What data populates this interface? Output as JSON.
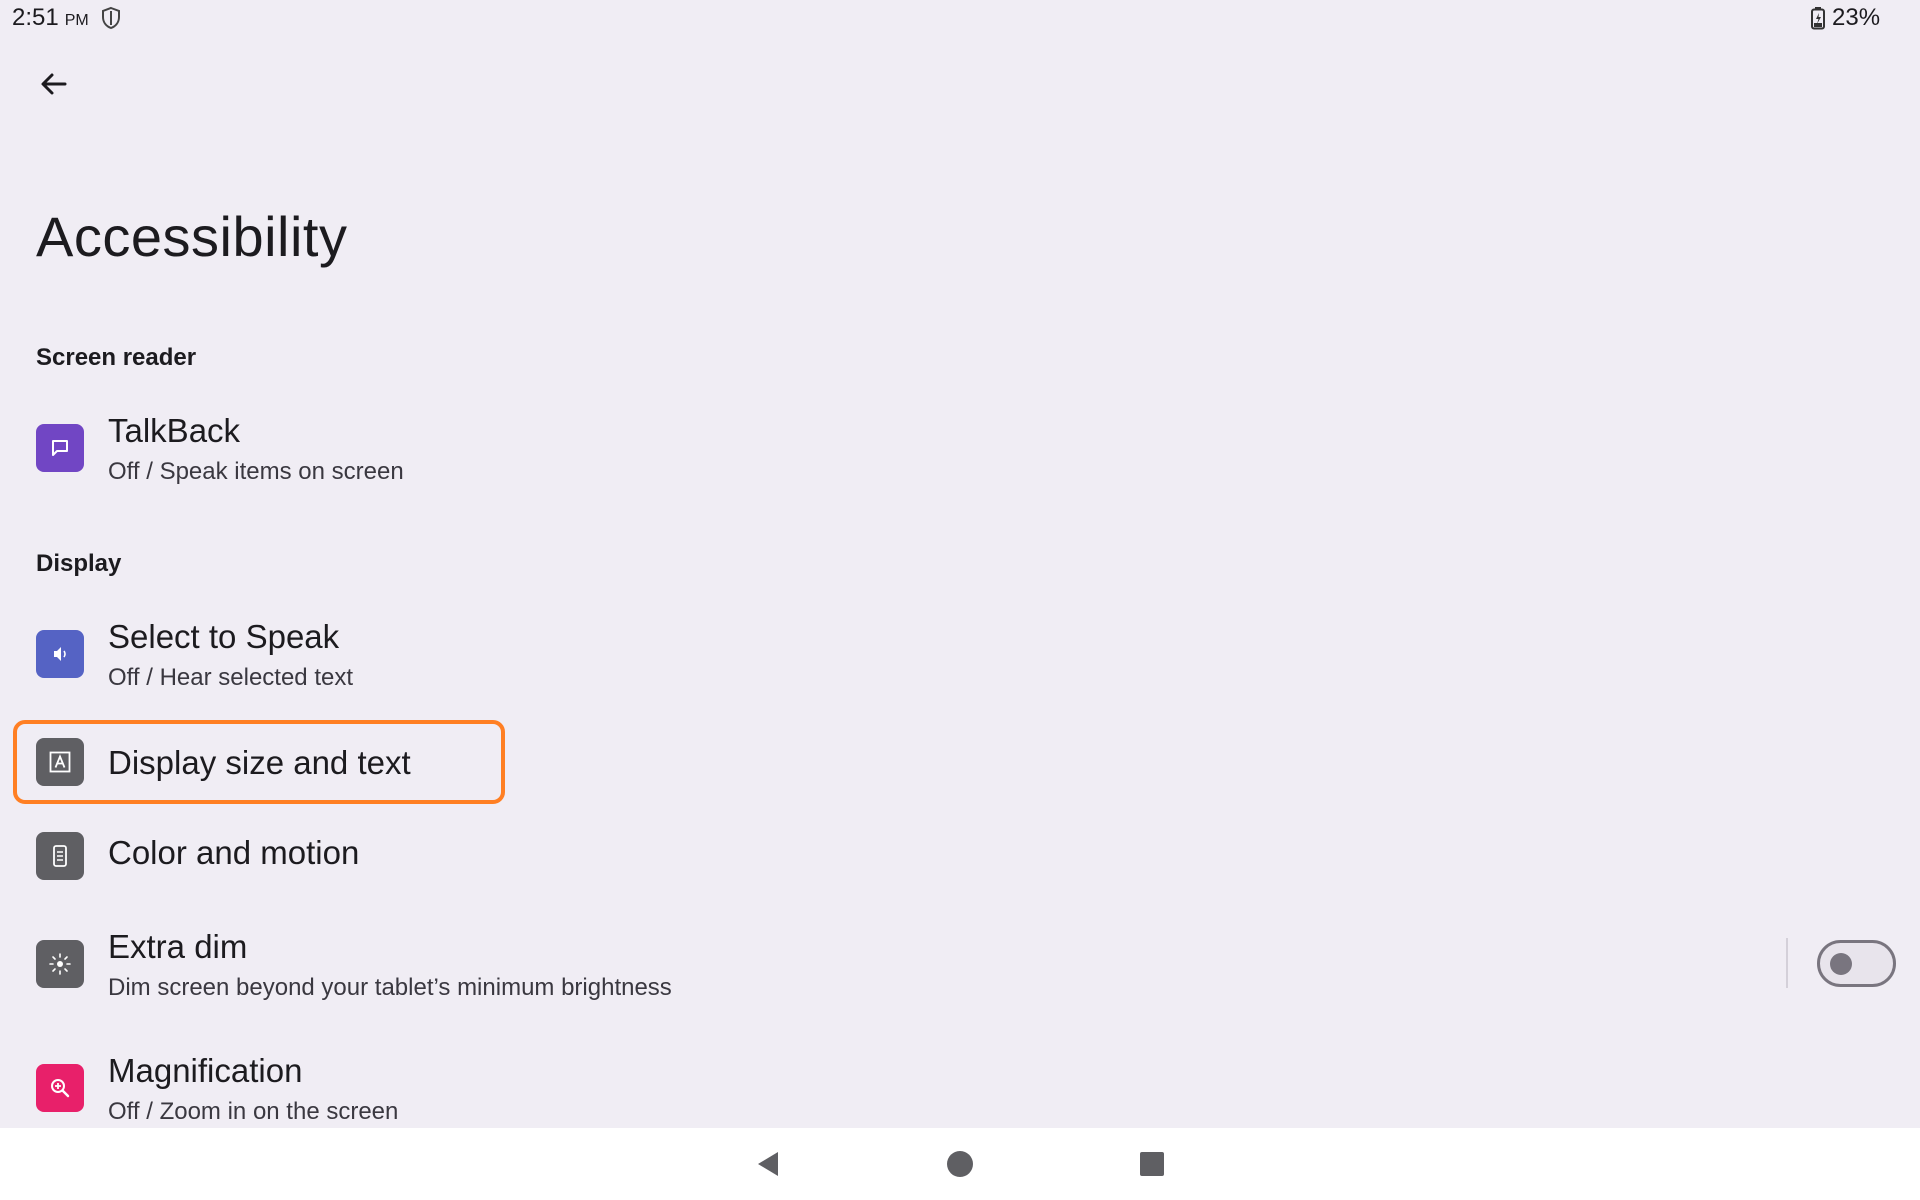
{
  "status_bar": {
    "time": "2:51",
    "ampm": "PM",
    "battery": "23%",
    "icons": [
      "shield-icon",
      "battery-charging-icon"
    ]
  },
  "header": {
    "back_icon": "arrow-left-icon",
    "title": "Accessibility"
  },
  "sections": {
    "screen_reader": "Screen reader",
    "display": "Display"
  },
  "items": {
    "talkback": {
      "title": "TalkBack",
      "subtitle": "Off / Speak items on screen",
      "icon": "chat-bubble-icon",
      "color": "#7146c4"
    },
    "select_to_speak": {
      "title": "Select to Speak",
      "subtitle": "Off / Hear selected text",
      "icon": "speaker-icon",
      "color": "#5563c4"
    },
    "display_size": {
      "title": "Display size and text",
      "icon": "text-size-icon",
      "color": "#5f5f63",
      "highlighted": true
    },
    "color_motion": {
      "title": "Color and motion",
      "icon": "phone-screen-icon",
      "color": "#5f5f63"
    },
    "extra_dim": {
      "title": "Extra dim",
      "subtitle": "Dim screen beyond your tablet’s minimum brightness",
      "icon": "brightness-icon",
      "color": "#5f5f63",
      "toggle_on": false
    },
    "magnification": {
      "title": "Magnification",
      "subtitle": "Off / Zoom in on the screen",
      "icon": "zoom-in-icon",
      "color": "#e8206a"
    }
  },
  "highlight_color": "#ff7f23",
  "nav_bar": {
    "buttons": [
      "back-triangle-icon",
      "home-circle-icon",
      "recents-square-icon"
    ]
  }
}
